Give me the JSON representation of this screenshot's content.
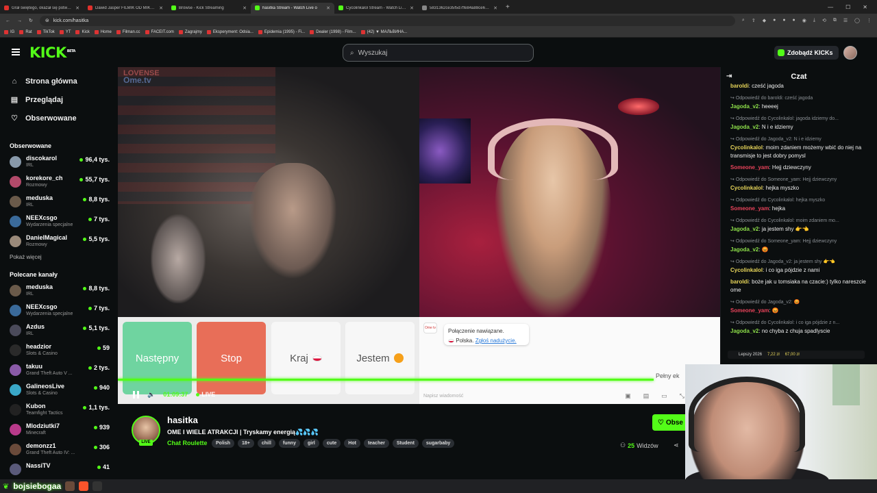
{
  "browser": {
    "tabs": [
      {
        "label": "Grał świętego, okazał się potworem",
        "color": "#e0312c",
        "active": false
      },
      {
        "label": "Dawid Jasper FILMIK OD MIKOŁAJA",
        "color": "#e0312c",
        "active": false
      },
      {
        "label": "Browse - Kick Streaming",
        "color": "#53fc18",
        "active": false
      },
      {
        "label": "hasitka Stream - Watch Live o",
        "color": "#53fc18",
        "active": true
      },
      {
        "label": "Cycolinkalol Stream - Watch Live on",
        "color": "#53fc18",
        "active": false
      },
      {
        "label": "5831362ce35f5d7ffe84a88ce695f2",
        "color": "#888888",
        "active": false
      }
    ],
    "url": "kick.com/hasitka",
    "bookmarks": [
      "IG",
      "Rat",
      "TikTok",
      "YT",
      "Kick",
      "Home",
      "Filman.cc",
      "FACEIT.com",
      "Zagrajmy",
      "Eksperyment: Odsia...",
      "Epidemia (1995) - Fi...",
      "Dealer (1998) - Film...",
      "(42) ▼ МАЛЬВИНА..."
    ]
  },
  "header": {
    "logo": "KICK",
    "logo_badge": "BETA",
    "search_placeholder": "Wyszukaj",
    "kicks_button": "Zdobądź KICKs"
  },
  "sidebar": {
    "nav": [
      {
        "label": "Strona główna",
        "icon": "home-icon",
        "glyph": "⌂"
      },
      {
        "label": "Przeglądaj",
        "icon": "browse-icon",
        "glyph": "▤"
      },
      {
        "label": "Obserwowane",
        "icon": "heart-icon",
        "glyph": "♡"
      }
    ],
    "followed_title": "Obserwowane",
    "followed": [
      {
        "name": "discokarol",
        "category": "IRL",
        "viewers": "96,4 tys.",
        "avatar": "#8899aa"
      },
      {
        "name": "korekore_ch",
        "category": "Rozmowy",
        "viewers": "55,7 tys.",
        "avatar": "#b24a6a"
      },
      {
        "name": "meduska",
        "category": "IRL",
        "viewers": "8,8 tys.",
        "avatar": "#6a5a4a"
      },
      {
        "name": "NEEXcsgo",
        "category": "Wydarzenia specjalne",
        "viewers": "7 tys.",
        "avatar": "#3a6a9a"
      },
      {
        "name": "DanielMagical",
        "category": "Rozmowy",
        "viewers": "5,5 tys.",
        "avatar": "#9a8a7a"
      }
    ],
    "show_more": "Pokaż więcej",
    "recommended_title": "Polecane kanały",
    "recommended": [
      {
        "name": "meduska",
        "category": "IRL",
        "viewers": "8,8 tys.",
        "avatar": "#6a5a4a"
      },
      {
        "name": "NEEXcsgo",
        "category": "Wydarzenia specjalne",
        "viewers": "7 tys.",
        "avatar": "#3a6a9a"
      },
      {
        "name": "Azdus",
        "category": "IRL",
        "viewers": "5,1 tys.",
        "avatar": "#4a4a5a"
      },
      {
        "name": "headzior",
        "category": "Slots & Casino",
        "viewers": "59",
        "avatar": "#2a2a2a"
      },
      {
        "name": "takuu",
        "category": "Grand Theft Auto V ...",
        "viewers": "2 tys.",
        "avatar": "#8a5aa8"
      },
      {
        "name": "GalineosLive",
        "category": "Slots & Casino",
        "viewers": "940",
        "avatar": "#3aa8c8"
      },
      {
        "name": "Kubon",
        "category": "Teamfight Tactics",
        "viewers": "1,1 tys.",
        "avatar": "#222222"
      },
      {
        "name": "Mlodziutki7",
        "category": "Minecraft",
        "viewers": "939",
        "avatar": "#b83a8a"
      },
      {
        "name": "demonzz1",
        "category": "Grand Theft Auto IV: ...",
        "viewers": "306",
        "avatar": "#6a4a3a"
      },
      {
        "name": "NassiTV",
        "category": "",
        "viewers": "41",
        "avatar": "#5a5a7a"
      }
    ]
  },
  "player": {
    "watermark_top": "LOVENSE",
    "watermark_bottom": "Ome.tv",
    "buttons": {
      "next": "Następny",
      "stop": "Stop",
      "country": "Kraj",
      "me": "Jestem"
    },
    "ome_logo": "Ome tv",
    "connection_line1": "Połączenie nawiązane.",
    "connection_country": "Polska.",
    "report_link": "Zgłoś nadużycie.",
    "message_placeholder": "Napisz wiadomość",
    "fullscreen_tip": "Pełny ek",
    "time": "01:09:37",
    "live": "LIVE",
    "progress": 0.89
  },
  "stream": {
    "name": "hasitka",
    "title": "OME I WIELE ATRAKCJI | Tryskamy energią💦💦💦",
    "category": "Chat Roulette",
    "live_badge": "LIVE",
    "tags": [
      "Polish",
      "18+",
      "chill",
      "funny",
      "girl",
      "cute",
      "Hot",
      "teacher",
      "Student",
      "sugarbaby"
    ],
    "follow": "Obse",
    "viewers_count": "25",
    "viewers_label": "Widzów"
  },
  "chat": {
    "title": "Czat",
    "messages": [
      {
        "reply": "",
        "user": "baroldi",
        "text": "cześć jagoda",
        "color": "#e8d65a"
      },
      {
        "reply": "Odpowiedź do baroldi: cześć jagoda",
        "user": "Jagoda_v2",
        "text": "heeeej",
        "color": "#8ee04a"
      },
      {
        "reply": "Odpowiedź do Cycolinkalol: jagoda idziemy do...",
        "user": "Jagoda_v2",
        "text": "N i e idziemy",
        "color": "#8ee04a"
      },
      {
        "reply": "Odpowiedź do Jagoda_v2: N i e idziemy",
        "user": "Cycolinkalol",
        "text": "moim zdaniem możemy wbić do niej na transmisje to jest dobry pomysl",
        "color": "#e8d65a"
      },
      {
        "reply": "",
        "user": "Someone_yam",
        "text": "Hejj dziewczyny",
        "color": "#e8435a"
      },
      {
        "reply": "Odpowiedź do Someone_yam: Hejj dziewczyny",
        "user": "Cycolinkalol",
        "text": "hejka myszko",
        "color": "#e8d65a"
      },
      {
        "reply": "Odpowiedź do Cycolinkalol: hejka myszko",
        "user": "Someone_yam",
        "text": "hejka",
        "color": "#e8435a"
      },
      {
        "reply": "Odpowiedź do Cycolinkalol: moim zdaniem mo...",
        "user": "Jagoda_v2",
        "text": "ja jestem shy 👉👈",
        "color": "#8ee04a"
      },
      {
        "reply": "Odpowiedź do Someone_yam: Hejj dziewczyny",
        "user": "Jagoda_v2",
        "text": "😡",
        "color": "#8ee04a"
      },
      {
        "reply": "Odpowiedź do Jagoda_v2: ja jestem shy 👉👈",
        "user": "Cycolinkalol",
        "text": "i co iga pójdzie z nami",
        "color": "#e8d65a"
      },
      {
        "reply": "",
        "user": "baroldi",
        "text": "boże jak u tomsiaka na czacie:) tylko nareszcie ome",
        "color": "#e8d65a"
      },
      {
        "reply": "Odpowiedź do Jagoda_v2: 😡",
        "user": "Someone_yam",
        "text": "😡",
        "color": "#e8435a"
      },
      {
        "reply": "Odpowiedź do Cycolinkalol: i co iga pójdzie z n...",
        "user": "Jagoda_v2",
        "text": "no chyba z chuja spadlyscie",
        "color": "#8ee04a"
      }
    ]
  },
  "donation": {
    "user": "Lepszy 2026",
    "amount1": "7,22 zł",
    "amount2": "67,00 zł"
  },
  "taskbar": {
    "title": "bojsiebogaa"
  }
}
